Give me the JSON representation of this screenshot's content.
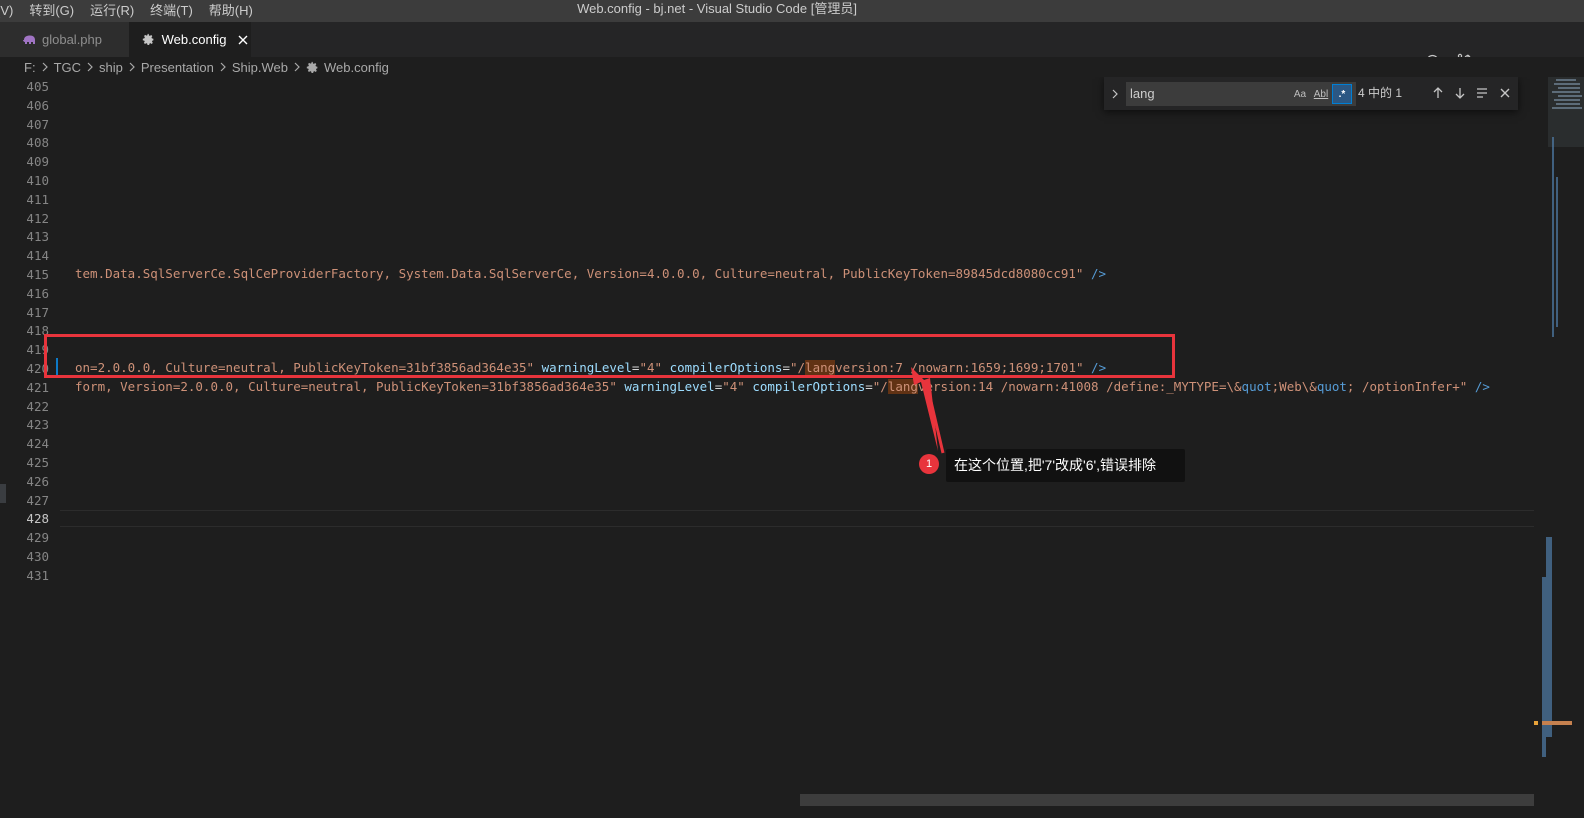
{
  "menu": {
    "items": [
      "(V)",
      "转到(G)",
      "运行(R)",
      "终端(T)",
      "帮助(H)"
    ]
  },
  "window": {
    "title": "Web.config - bj.net - Visual Studio Code [管理员]"
  },
  "tabs": [
    {
      "label": "global.php",
      "icon": "php-elephant-icon",
      "active": false
    },
    {
      "label": "Web.config",
      "icon": "gear-icon",
      "active": true
    }
  ],
  "editor_actions": [
    "history-icon",
    "compare-changes-icon",
    "git-commit-icon",
    "previous-change-icon",
    "next-change-icon"
  ],
  "breadcrumb": {
    "items": [
      "F:",
      "TGC",
      "ship",
      "Presentation",
      "Ship.Web",
      "Web.config"
    ]
  },
  "find": {
    "query": "lang",
    "match_case_label": "Aa",
    "whole_word_label": "Abl",
    "regex_label": ".*",
    "count": "4 中的 1"
  },
  "lines": {
    "first": 405,
    "last": 431,
    "active": 428
  },
  "code": {
    "l415": {
      "text": "tem.Data.SqlServerCe.SqlCeProviderFactory, System.Data.SqlServerCe, Version=4.0.0.0, Culture=neutral, PublicKeyToken=89845dcd8080cc91\"",
      "end": " />"
    },
    "l420": {
      "s1": "on=2.0.0.0, Culture=neutral, PublicKeyToken=31bf3856ad364e35\"",
      "attr1": "warningLevel",
      "eq1": "=",
      "v1": "\"4\"",
      "attr2": "compilerOptions",
      "eq2": "=",
      "v2a": "\"/",
      "match": "lang",
      "v2b": "version:7 /nowarn:1659;1699;1701\"",
      "end": " />"
    },
    "l421": {
      "s1": "form, Version=2.0.0.0, Culture=neutral, PublicKeyToken=31bf3856ad364e35\"",
      "attr1": "warningLevel",
      "eq1": "=",
      "v1": "\"4\"",
      "attr2": "compilerOptions",
      "eq2": "=",
      "v2a": "\"/",
      "match": "lang",
      "v2b": "version:14 /nowarn:41008 /define:_MYTYPE=\\&",
      "q1": "quot",
      "v2c": ";Web\\&",
      "q2": "quot",
      "v2d": "; /optionInfer+\"",
      "end": " />"
    }
  },
  "annotation": {
    "number": "1",
    "text": "在这个位置,把'7'改成'6',错误排除",
    "color": "#e8343c"
  },
  "colors": {
    "background": "#1e1e1e",
    "string": "#ce9178",
    "attribute": "#9cdcfe",
    "accent": "#0e7ac7"
  }
}
